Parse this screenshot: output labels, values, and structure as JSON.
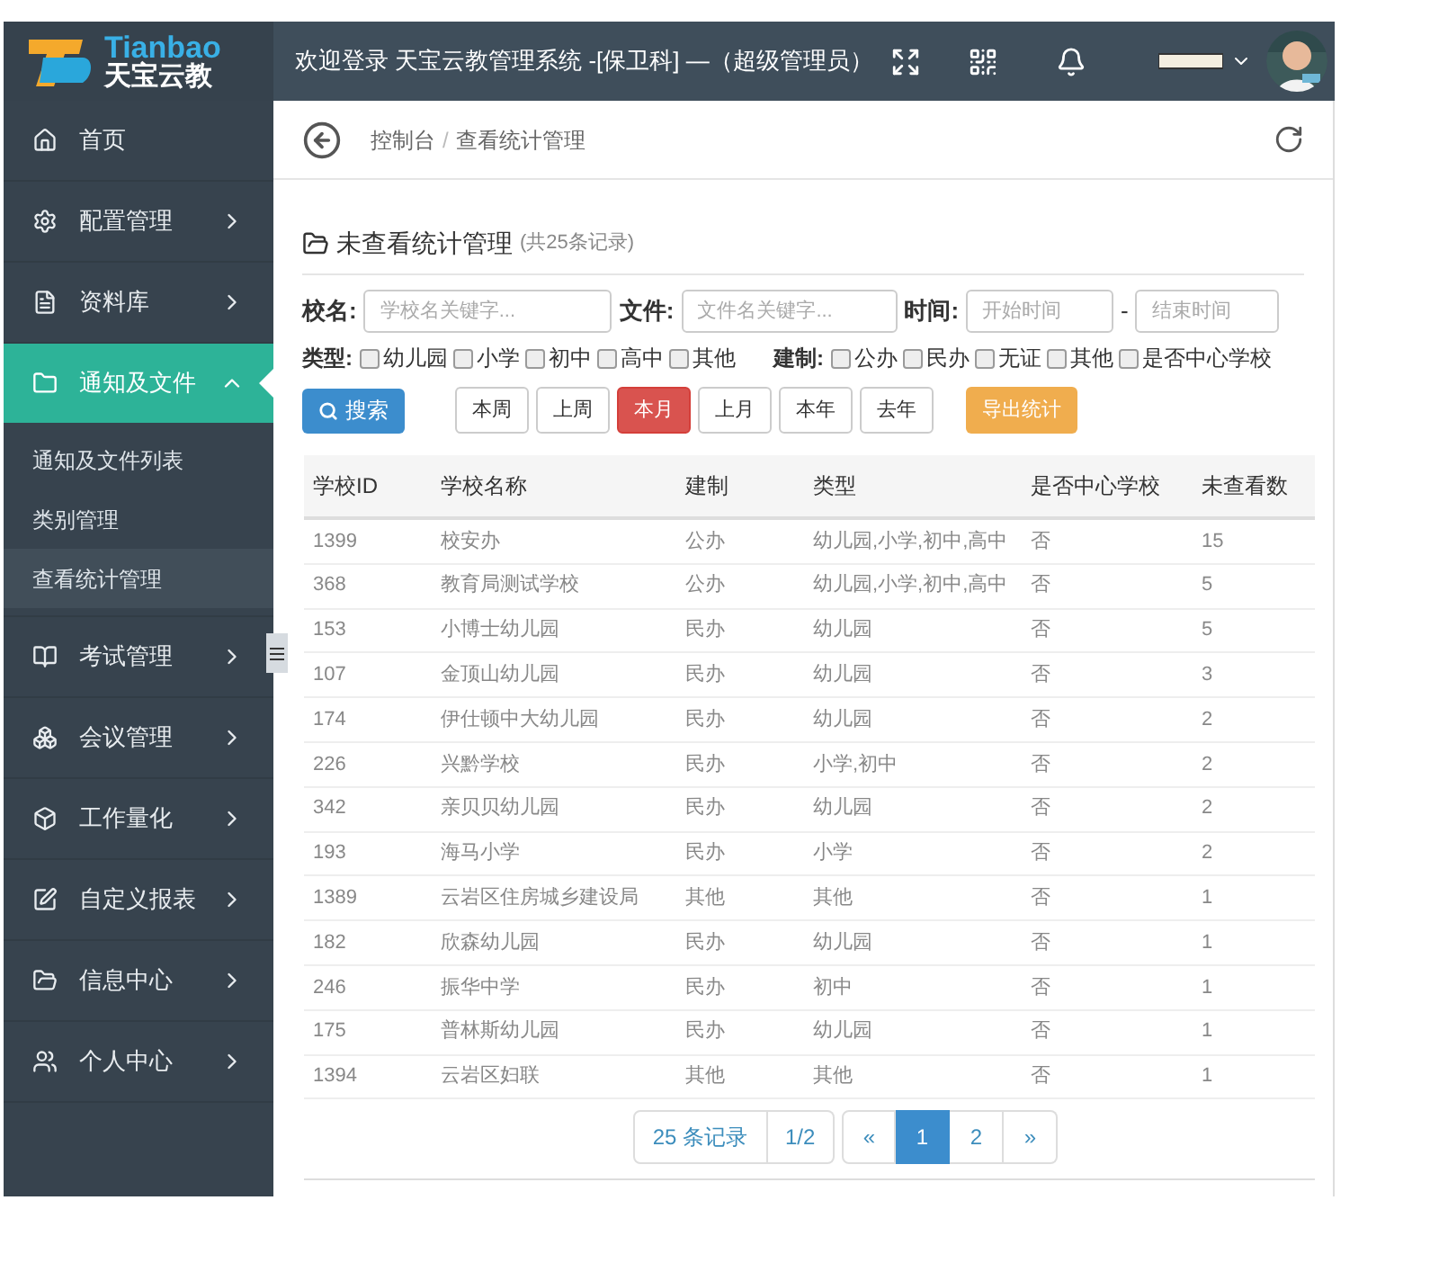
{
  "logo": {
    "en": "Tianbao",
    "cn": "天宝云教"
  },
  "header": {
    "title": "欢迎登录 天宝云教管理系统 -[保卫科] —（超级管理员）"
  },
  "sidebar": {
    "items": [
      {
        "label": "首页",
        "kind": "link",
        "expanded": false
      },
      {
        "label": "配置管理",
        "kind": "menu",
        "expanded": false
      },
      {
        "label": "资料库",
        "kind": "menu",
        "expanded": false
      },
      {
        "label": "通知及文件",
        "kind": "menu",
        "expanded": true,
        "children": [
          {
            "label": "通知及文件列表",
            "selected": false
          },
          {
            "label": "类别管理",
            "selected": false
          },
          {
            "label": "查看统计管理",
            "selected": true
          }
        ]
      },
      {
        "label": "考试管理",
        "kind": "menu",
        "expanded": false
      },
      {
        "label": "会议管理",
        "kind": "menu",
        "expanded": false
      },
      {
        "label": "工作量化",
        "kind": "menu",
        "expanded": false
      },
      {
        "label": "自定义报表",
        "kind": "menu",
        "expanded": false
      },
      {
        "label": "信息中心",
        "kind": "menu",
        "expanded": false
      },
      {
        "label": "个人中心",
        "kind": "menu",
        "expanded": false
      }
    ]
  },
  "breadcrumb": {
    "items": [
      "控制台",
      "查看统计管理"
    ],
    "separator": "/"
  },
  "panel": {
    "title": "未查看统计管理",
    "count": "(共25条记录)"
  },
  "filters": {
    "school_label": "校名:",
    "school_placeholder": "学校名关键字...",
    "file_label": "文件:",
    "file_placeholder": "文件名关键字...",
    "time_label": "时间:",
    "start_placeholder": "开始时间",
    "dash": "-",
    "end_placeholder": "结束时间",
    "type_label": "类型:",
    "types": [
      {
        "label": "幼儿园",
        "checked": false
      },
      {
        "label": "小学",
        "checked": false
      },
      {
        "label": "初中",
        "checked": false
      },
      {
        "label": "高中",
        "checked": false
      },
      {
        "label": "其他",
        "checked": false
      }
    ],
    "system_label": "建制:",
    "systems": [
      {
        "label": "公办",
        "checked": false
      },
      {
        "label": "民办",
        "checked": false
      },
      {
        "label": "无证",
        "checked": false
      },
      {
        "label": "其他",
        "checked": false
      },
      {
        "label": "是否中心学校",
        "checked": false
      }
    ]
  },
  "search_button": "搜索",
  "periods": [
    {
      "label": "本周",
      "selected": false
    },
    {
      "label": "上周",
      "selected": false
    },
    {
      "label": "本月",
      "selected": true
    },
    {
      "label": "上月",
      "selected": false
    },
    {
      "label": "本年",
      "selected": false
    },
    {
      "label": "去年",
      "selected": false
    }
  ],
  "export_button": "导出统计",
  "table": {
    "columns": [
      "学校ID",
      "学校名称",
      "建制",
      "类型",
      "是否中心学校",
      "未查看数"
    ],
    "rows": [
      [
        "1399",
        "校安办",
        "公办",
        "幼儿园,小学,初中,高中",
        "否",
        "15"
      ],
      [
        "368",
        "教育局测试学校",
        "公办",
        "幼儿园,小学,初中,高中",
        "否",
        "5"
      ],
      [
        "153",
        "小博士幼儿园",
        "民办",
        "幼儿园",
        "否",
        "5"
      ],
      [
        "107",
        "金顶山幼儿园",
        "民办",
        "幼儿园",
        "否",
        "3"
      ],
      [
        "174",
        "伊仕顿中大幼儿园",
        "民办",
        "幼儿园",
        "否",
        "2"
      ],
      [
        "226",
        "兴黔学校",
        "民办",
        "小学,初中",
        "否",
        "2"
      ],
      [
        "342",
        "亲贝贝幼儿园",
        "民办",
        "幼儿园",
        "否",
        "2"
      ],
      [
        "193",
        "海马小学",
        "民办",
        "小学",
        "否",
        "2"
      ],
      [
        "1389",
        "云岩区住房城乡建设局",
        "其他",
        "其他",
        "否",
        "1"
      ],
      [
        "182",
        "欣森幼儿园",
        "民办",
        "幼儿园",
        "否",
        "1"
      ],
      [
        "246",
        "振华中学",
        "民办",
        "初中",
        "否",
        "1"
      ],
      [
        "175",
        "普林斯幼儿园",
        "民办",
        "幼儿园",
        "否",
        "1"
      ],
      [
        "1394",
        "云岩区妇联",
        "其他",
        "其他",
        "否",
        "1"
      ]
    ]
  },
  "pagination": {
    "total": "25 条记录",
    "page_info": "1/2",
    "prev": "«",
    "pages": [
      {
        "label": "1",
        "selected": true
      },
      {
        "label": "2",
        "selected": false
      }
    ],
    "next": "»"
  }
}
